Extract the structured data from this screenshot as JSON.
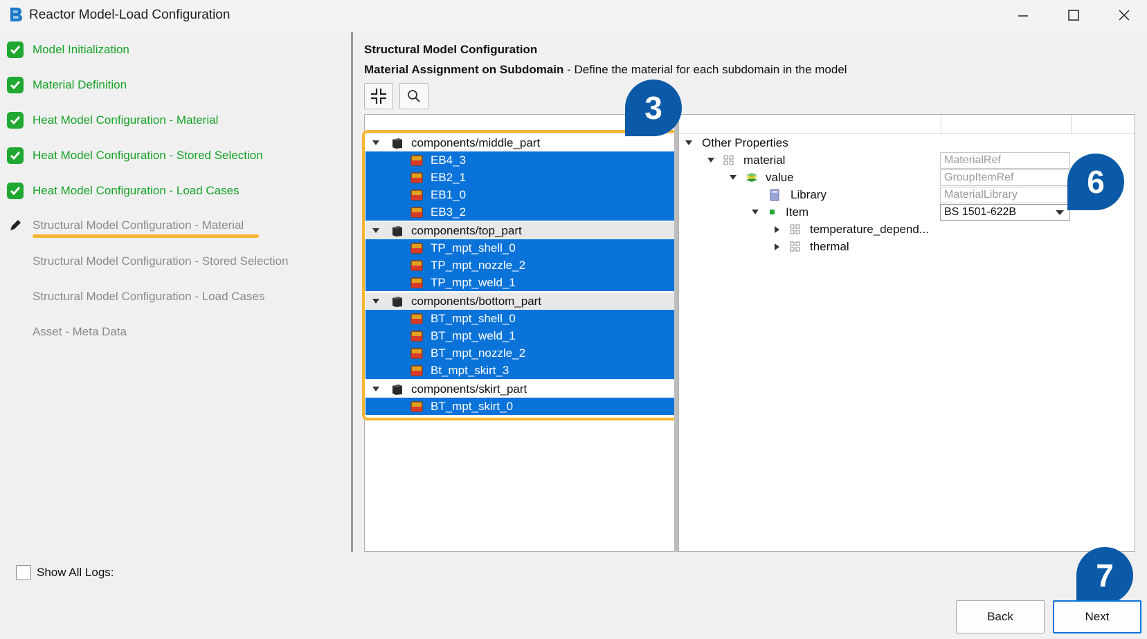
{
  "window": {
    "title": "Reactor Model-Load Configuration"
  },
  "steps": [
    {
      "label": "Model Initialization",
      "state": "done"
    },
    {
      "label": "Material Definition",
      "state": "done"
    },
    {
      "label": "Heat Model Configuration - Material",
      "state": "done"
    },
    {
      "label": "Heat Model Configuration - Stored Selection",
      "state": "done"
    },
    {
      "label": "Heat Model Configuration - Load Cases",
      "state": "done"
    },
    {
      "label": "Structural Model Configuration - Material",
      "state": "current"
    },
    {
      "label": "Structural Model Configuration - Stored Selection",
      "state": "pending"
    },
    {
      "label": "Structural Model Configuration - Load Cases",
      "state": "pending"
    },
    {
      "label": "Asset - Meta Data",
      "state": "pending"
    }
  ],
  "main": {
    "title": "Structural Model Configuration",
    "subtitle_bold": "Material Assignment on Subdomain",
    "subtitle_rest": " - Define the material for each subdomain in the model"
  },
  "tree": {
    "groups": [
      {
        "name": "components/middle_part",
        "items": [
          "EB4_3",
          "EB2_1",
          "EB1_0",
          "EB3_2"
        ]
      },
      {
        "name": "components/top_part",
        "items": [
          "TP_mpt_shell_0",
          "TP_mpt_nozzle_2",
          "TP_mpt_weld_1"
        ]
      },
      {
        "name": "components/bottom_part",
        "items": [
          "BT_mpt_shell_0",
          "BT_mpt_weld_1",
          "BT_mpt_nozzle_2",
          "Bt_mpt_skirt_3"
        ]
      },
      {
        "name": "components/skirt_part",
        "items": [
          "BT_mpt_skirt_0"
        ]
      }
    ]
  },
  "properties": {
    "root": "Other Properties",
    "material": {
      "label": "material",
      "value": "MaterialRef"
    },
    "value": {
      "label": "value",
      "value": "GroupItemRef"
    },
    "library": {
      "label": "Library",
      "value": "MaterialLibrary"
    },
    "item": {
      "label": "Item",
      "value": "BS 1501-622B"
    },
    "temperature": {
      "label": "temperature_depend..."
    },
    "thermal": {
      "label": "thermal"
    }
  },
  "badges": {
    "b3": "3",
    "b6": "6",
    "b7": "7"
  },
  "footer": {
    "show_logs": "Show All Logs:",
    "back": "Back",
    "next": "Next"
  },
  "colors": {
    "done_green": "#16a326",
    "selection_blue": "#0a73d9",
    "highlight_orange": "#f7b530",
    "badge_blue": "#0b5aa8"
  }
}
